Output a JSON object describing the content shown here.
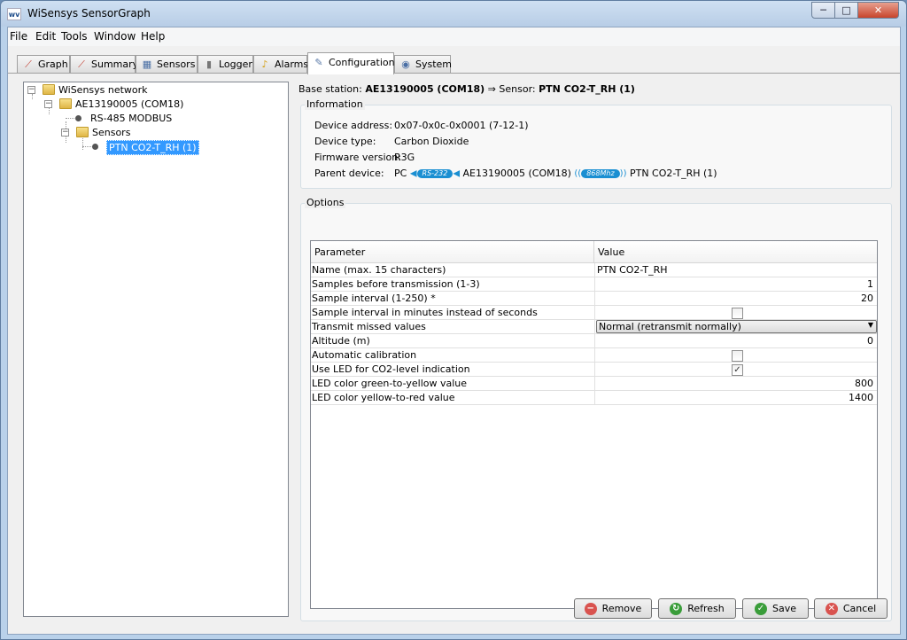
{
  "window": {
    "title": "WiSensys SensorGraph",
    "app_icon": "wv",
    "min": "─",
    "max": "□",
    "close": "✕"
  },
  "menu": [
    "File",
    "Edit",
    "Tools",
    "Window",
    "Help"
  ],
  "tabs": [
    "Graph",
    "Summary",
    "Sensors",
    "Logger",
    "Alarms",
    "Configuration",
    "System"
  ],
  "tree": {
    "root": "WiSensys network",
    "station": "AE13190005 (COM18)",
    "modbus": "RS-485 MODBUS",
    "sensors": "Sensors",
    "sensor": "PTN CO2-T_RH (1)"
  },
  "heading": {
    "prefix": "Base station: ",
    "station": "AE13190005 (COM18)",
    "mid": " ⇒ Sensor: ",
    "sensor": "PTN CO2-T_RH (1)"
  },
  "information": {
    "title": "Information",
    "address_label": "Device address:",
    "address": "0x07-0x0c-0x0001 (7-12-1)",
    "type_label": "Device type:",
    "type": "Carbon Dioxide",
    "firmware_label": "Firmware version:",
    "firmware": "R3G",
    "parent_label": "Parent device:",
    "parent_pc": "PC",
    "link1": "RS-232",
    "parent_station": "AE13190005 (COM18)",
    "link2": "868Mhz",
    "parent_sensor": "PTN CO2-T_RH (1)"
  },
  "options": {
    "title": "Options",
    "col_param": "Parameter",
    "col_value": "Value",
    "rows": [
      {
        "param": "Name (max. 15 characters)",
        "value": "PTN CO2-T_RH"
      },
      {
        "param": "Samples before transmission (1-3)",
        "value": "1"
      },
      {
        "param": "Sample interval (1-250) *",
        "value": "20"
      },
      {
        "param": "Sample interval in minutes instead of seconds",
        "checked": false
      },
      {
        "param": "Transmit missed values",
        "value": "Normal (retransmit normally)"
      },
      {
        "param": "Altitude (m)",
        "value": "0"
      },
      {
        "param": "Automatic calibration",
        "checked": false
      },
      {
        "param": "Use LED for CO2-level indication",
        "checked": true
      },
      {
        "param": "LED color green-to-yellow value",
        "value": "800"
      },
      {
        "param": "LED color yellow-to-red value",
        "value": "1400"
      }
    ]
  },
  "buttons": {
    "remove": "Remove",
    "refresh": "Refresh",
    "save": "Save",
    "cancel": "Cancel"
  },
  "check_mark": "✓",
  "dropdown_arrow": "▼",
  "colors": {
    "selection": "#3399ff",
    "link": "#1a8fd2"
  }
}
